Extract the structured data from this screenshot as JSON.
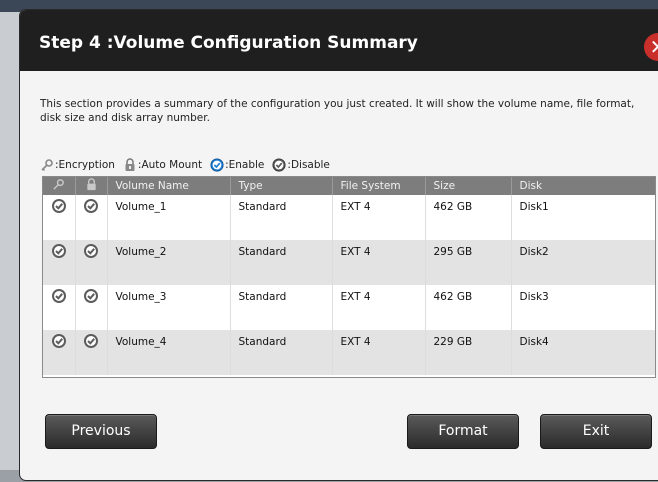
{
  "dialog": {
    "title": "Step 4 :Volume Configuration Summary",
    "close_symbol": "✕",
    "description": "This section provides a summary of the configuration you just created. It will show the volume name, file format, disk size and disk array number."
  },
  "legend": {
    "encryption": ":Encryption",
    "auto_mount": ":Auto Mount",
    "enable": ":Enable",
    "disable": ":Disable"
  },
  "table": {
    "headers": [
      "Volume Name",
      "Type",
      "File System",
      "Size",
      "Disk"
    ],
    "rows": [
      {
        "name": "Volume_1",
        "type": "Standard",
        "fs": "EXT 4",
        "size": "462 GB",
        "disk": "Disk1"
      },
      {
        "name": "Volume_2",
        "type": "Standard",
        "fs": "EXT 4",
        "size": "295 GB",
        "disk": "Disk2"
      },
      {
        "name": "Volume_3",
        "type": "Standard",
        "fs": "EXT 4",
        "size": "462 GB",
        "disk": "Disk3"
      },
      {
        "name": "Volume_4",
        "type": "Standard",
        "fs": "EXT 4",
        "size": "229 GB",
        "disk": "Disk4"
      }
    ]
  },
  "buttons": {
    "previous": "Previous",
    "format": "Format",
    "exit": "Exit"
  },
  "icons": {
    "encryption": "key-icon",
    "auto_mount": "lock-icon",
    "enable": "check-circle-blue-icon",
    "disable": "check-circle-gray-icon"
  },
  "colors": {
    "titlebar": "#1f1f1f",
    "header_row": "#7d7d7d",
    "alt_row": "#e3e3e3",
    "close_button": "#c9302c",
    "enable_blue": "#1f7fd6",
    "disable_gray": "#5c5c5c"
  }
}
